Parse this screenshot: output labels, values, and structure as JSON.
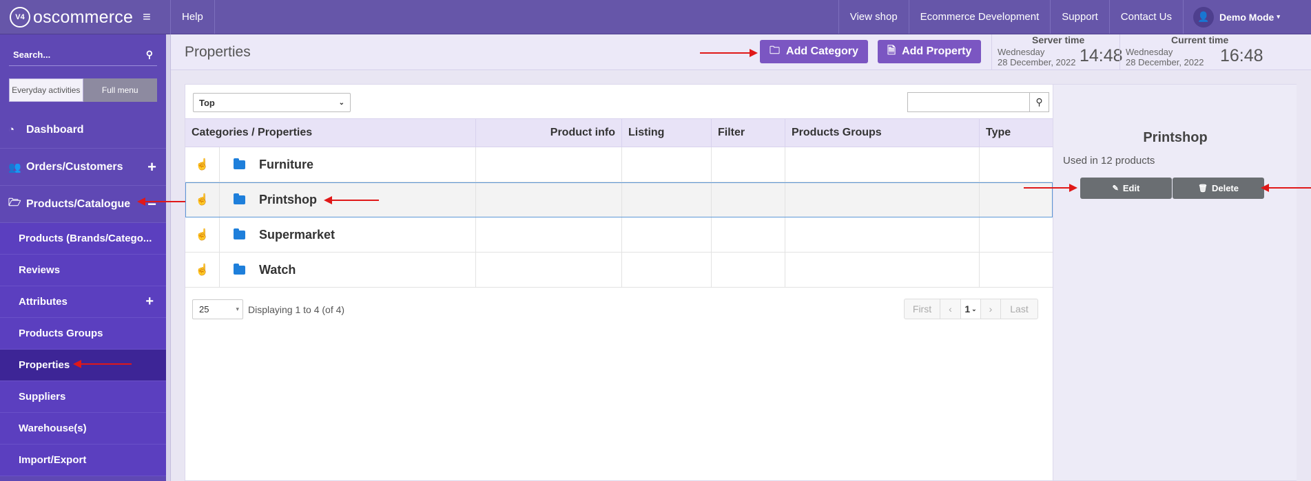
{
  "brand": {
    "logo_text": "oscommerce",
    "logo_mark": "V4"
  },
  "topbar": {
    "help": "Help",
    "links": [
      "View shop",
      "Ecommerce Development",
      "Support",
      "Contact Us"
    ],
    "user": "Demo Mode"
  },
  "sidebar": {
    "search_placeholder": "Search...",
    "switch": {
      "everyday": "Everyday activities",
      "full": "Full menu"
    },
    "items": [
      {
        "label": "Dashboard",
        "icon": "dashboard-icon"
      },
      {
        "label": "Orders/Customers",
        "icon": "users-icon"
      },
      {
        "label": "Products/Catalogue",
        "icon": "folder-open-icon"
      }
    ],
    "subitems": [
      "Products (Brands/Catego...",
      "Reviews",
      "Attributes",
      "Products Groups",
      "Properties",
      "Suppliers",
      "Warehouse(s)",
      "Import/Export"
    ]
  },
  "header": {
    "title": "Properties",
    "add_category": "Add Category",
    "add_property": "Add Property",
    "server_time": {
      "label": "Server time",
      "day": "Wednesday",
      "date": "28 December, 2022",
      "time": "14:48"
    },
    "current_time": {
      "label": "Current time",
      "day": "Wednesday",
      "date": "28 December, 2022",
      "time": "16:48"
    }
  },
  "filter": {
    "selected": "Top"
  },
  "table": {
    "columns": [
      "Categories / Properties",
      "Product info",
      "Listing",
      "Filter",
      "Products Groups",
      "Type"
    ],
    "rows": [
      "Furniture",
      "Printshop",
      "Supermarket",
      "Watch"
    ],
    "selected_row": 1
  },
  "pager": {
    "page_size": "25",
    "displaying": "Displaying 1 to 4 (of 4)",
    "first": "First",
    "last": "Last",
    "current": "1"
  },
  "info": {
    "title": "Printshop",
    "used": "Used in 12 products",
    "edit": "Edit",
    "delete": "Delete"
  },
  "colors": {
    "topbar": "#6656a9",
    "sidebar": "#5f48b4",
    "accent_button": "#7b56c2",
    "folder": "#1e7fdb",
    "annotation_arrow": "#e01818"
  }
}
